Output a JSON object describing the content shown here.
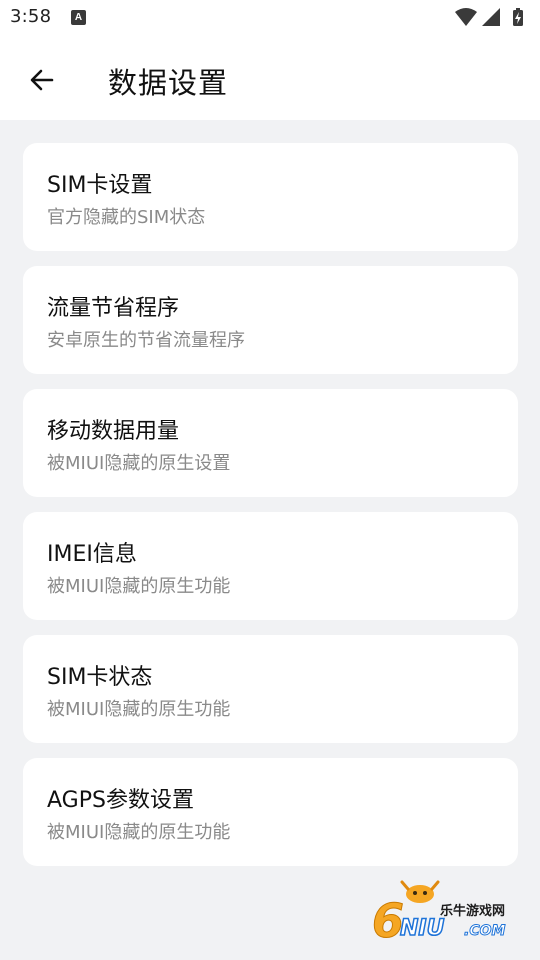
{
  "status_bar": {
    "time": "3:58",
    "notification_icon": "a-icon",
    "icons": [
      "wifi-icon",
      "signal-icon",
      "battery-charging-icon"
    ]
  },
  "app_bar": {
    "back_icon": "arrow-left-icon",
    "title": "数据设置"
  },
  "items": [
    {
      "title": "SIM卡设置",
      "subtitle": "官方隐藏的SIM状态"
    },
    {
      "title": "流量节省程序",
      "subtitle": "安卓原生的节省流量程序"
    },
    {
      "title": "移动数据用量",
      "subtitle": "被MIUI隐藏的原生设置"
    },
    {
      "title": "IMEI信息",
      "subtitle": "被MIUI隐藏的原生功能"
    },
    {
      "title": "SIM卡状态",
      "subtitle": "被MIUI隐藏的原生功能"
    },
    {
      "title": "AGPS参数设置",
      "subtitle": "被MIUI隐藏的原生功能"
    }
  ],
  "watermark": {
    "logo_text": "6NIU.COM",
    "name": "乐牛游戏网"
  },
  "colors": {
    "background": "#f1f2f4",
    "card": "#ffffff",
    "subtitle": "#8a8a8a",
    "watermark_orange": "#f5a623"
  }
}
